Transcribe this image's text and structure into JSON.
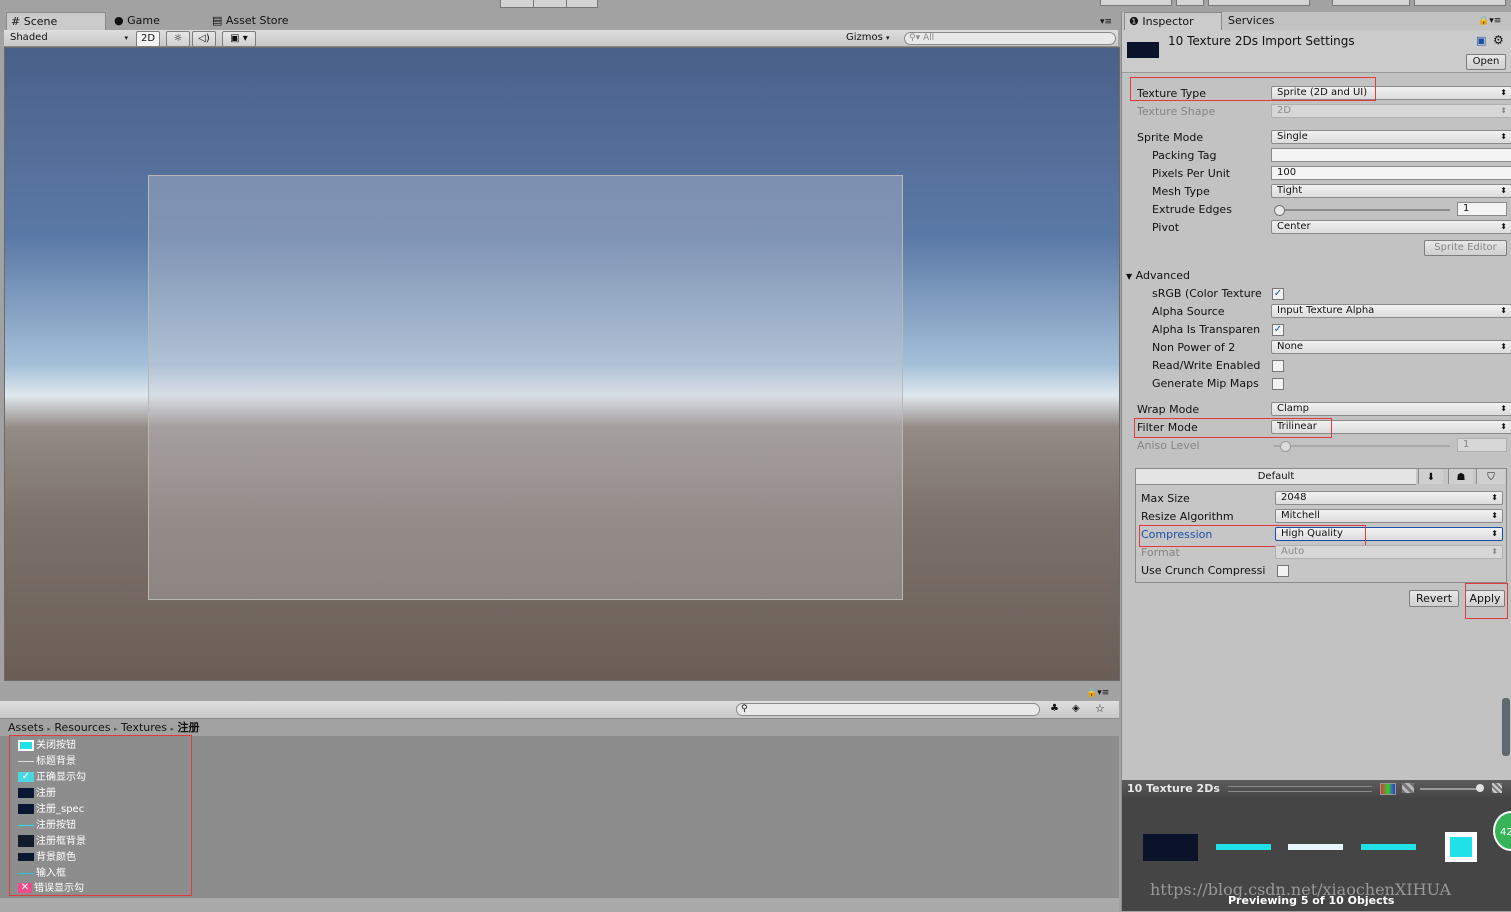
{
  "scene_tabs": {
    "scene": "Scene",
    "game": "Game",
    "asset_store": "Asset Store"
  },
  "scene_toolbar": {
    "shading": "Shaded",
    "mode_2d": "2D",
    "gizmos": "Gizmos",
    "search_placeholder": "All"
  },
  "inspector": {
    "tabs": {
      "inspector": "Inspector",
      "services": "Services"
    },
    "title": "10 Texture 2Ds Import Settings",
    "open": "Open",
    "texture_type": {
      "label": "Texture Type",
      "value": "Sprite (2D and UI)"
    },
    "texture_shape": {
      "label": "Texture Shape",
      "value": "2D"
    },
    "sprite_mode": {
      "label": "Sprite Mode",
      "value": "Single"
    },
    "packing_tag": {
      "label": "Packing Tag",
      "value": ""
    },
    "pixels_per_unit": {
      "label": "Pixels Per Unit",
      "value": "100"
    },
    "mesh_type": {
      "label": "Mesh Type",
      "value": "Tight"
    },
    "extrude_edges": {
      "label": "Extrude Edges",
      "value": "1"
    },
    "pivot": {
      "label": "Pivot",
      "value": "Center"
    },
    "sprite_editor": "Sprite Editor",
    "advanced": "Advanced",
    "srgb": {
      "label": "sRGB (Color Texture",
      "checked": true
    },
    "alpha_source": {
      "label": "Alpha Source",
      "value": "Input Texture Alpha"
    },
    "alpha_transparency": {
      "label": "Alpha Is Transparen",
      "checked": true
    },
    "non_power_of_2": {
      "label": "Non Power of 2",
      "value": "None"
    },
    "read_write": {
      "label": "Read/Write Enabled",
      "checked": false
    },
    "mip_maps": {
      "label": "Generate Mip Maps",
      "checked": false
    },
    "wrap_mode": {
      "label": "Wrap Mode",
      "value": "Clamp"
    },
    "filter_mode": {
      "label": "Filter Mode",
      "value": "Trilinear"
    },
    "aniso_level": {
      "label": "Aniso Level",
      "value": "1"
    },
    "platform": {
      "header": "Default",
      "max_size": {
        "label": "Max Size",
        "value": "2048"
      },
      "resize": {
        "label": "Resize Algorithm",
        "value": "Mitchell"
      },
      "compression": {
        "label": "Compression",
        "value": "High Quality"
      },
      "format": {
        "label": "Format",
        "value": "Auto"
      },
      "crunch": {
        "label": "Use Crunch Compressi",
        "checked": false
      }
    },
    "revert": "Revert",
    "apply": "Apply"
  },
  "preview": {
    "title": "10 Texture 2Ds",
    "caption": "Previewing 5 of 10 Objects",
    "badge": "42",
    "watermark": "https://blog.csdn.net/xiaochenXIHUA"
  },
  "project": {
    "breadcrumb": [
      "Assets",
      "Resources",
      "Textures",
      "注册"
    ],
    "assets": [
      "关闭按钮",
      "标题背景",
      "正确显示勾",
      "注册",
      "注册_spec",
      "注册按钮",
      "注册框背景",
      "背景颜色",
      "输入框",
      "错误显示勾"
    ]
  },
  "colors": {
    "accent": "#1a4fa8",
    "highlight": "#e23b3b",
    "sky_top": "#4d6690",
    "ground": "#6e6259"
  }
}
